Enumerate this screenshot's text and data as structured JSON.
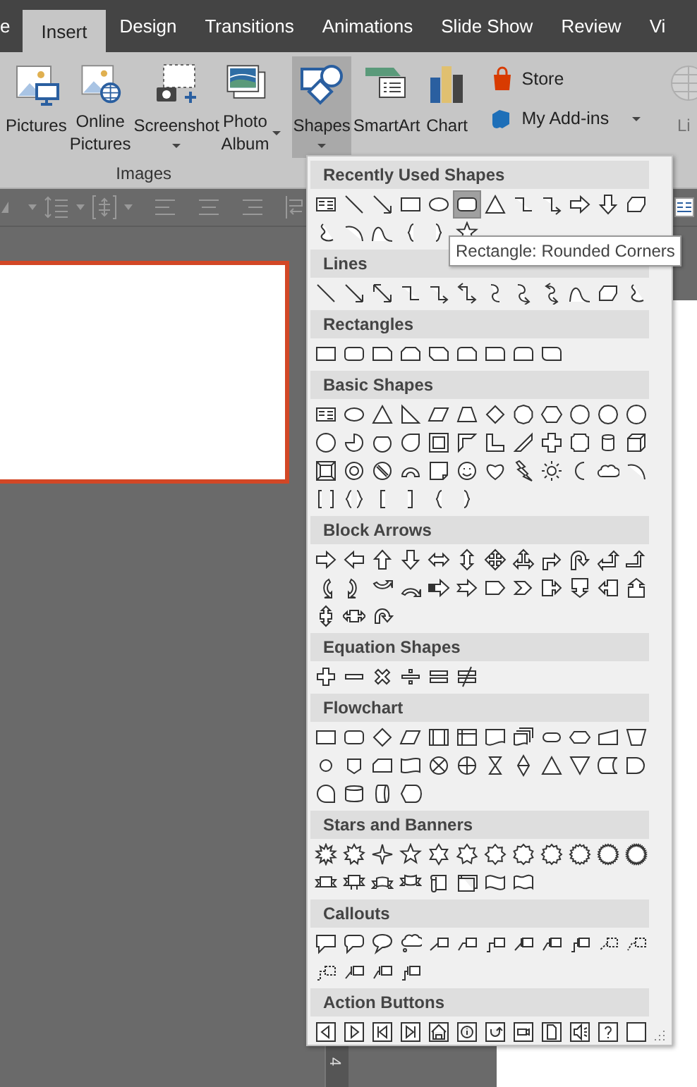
{
  "tabs": [
    {
      "label": "e",
      "selected": false
    },
    {
      "label": "Insert",
      "selected": true
    },
    {
      "label": "Design",
      "selected": false
    },
    {
      "label": "Transitions",
      "selected": false
    },
    {
      "label": "Animations",
      "selected": false
    },
    {
      "label": "Slide Show",
      "selected": false
    },
    {
      "label": "Review",
      "selected": false
    },
    {
      "label": "Vi",
      "selected": false
    }
  ],
  "ribbon": {
    "groups": [
      {
        "label": "Images",
        "buttons": [
          {
            "kind": "pictures",
            "label": "Pictures",
            "dropdown": false,
            "pressed": false,
            "disabled": false
          },
          {
            "kind": "online-pictures",
            "label": "Online Pictures",
            "dropdown": false,
            "pressed": false,
            "disabled": false
          },
          {
            "kind": "screenshot",
            "label": "Screenshot",
            "dropdown": true,
            "pressed": false,
            "disabled": false
          },
          {
            "kind": "photo-album",
            "label": "Photo Album",
            "dropdown": true,
            "pressed": false,
            "disabled": false
          }
        ]
      },
      {
        "buttons": [
          {
            "kind": "shapes",
            "label": "Shapes",
            "dropdown": true,
            "pressed": true,
            "disabled": false
          },
          {
            "kind": "smartart",
            "label": "SmartArt",
            "dropdown": false,
            "pressed": false,
            "disabled": false
          },
          {
            "kind": "chart",
            "label": "Chart",
            "dropdown": false,
            "pressed": false,
            "disabled": false
          }
        ]
      },
      {
        "buttons": [
          {
            "kind": "store",
            "label": "Store",
            "dropdown": false,
            "pressed": false,
            "disabled": false
          },
          {
            "kind": "addins",
            "label": "My Add-ins",
            "dropdown": true,
            "pressed": false,
            "disabled": false
          }
        ]
      },
      {
        "buttons": [
          {
            "kind": "link",
            "label": "Li",
            "dropdown": false,
            "pressed": false,
            "disabled": true
          }
        ]
      }
    ]
  },
  "gallery": {
    "sections": [
      {
        "title": "Recently Used Shapes",
        "items": [
          {
            "selected": false
          },
          {
            "selected": false
          },
          {
            "selected": false
          },
          {
            "selected": false
          },
          {
            "selected": false
          },
          {
            "selected": true
          },
          {
            "selected": false
          },
          {
            "selected": false
          },
          {
            "selected": false
          },
          {
            "selected": false
          },
          {
            "selected": false
          },
          {
            "selected": false
          },
          {
            "selected": false
          },
          {
            "selected": false
          },
          {
            "selected": false
          },
          {
            "selected": false
          },
          {
            "selected": false
          },
          {
            "selected": false
          }
        ]
      },
      {
        "title": "Lines"
      },
      {
        "title": "Rectangles"
      },
      {
        "title": "Basic Shapes"
      },
      {
        "title": "Block Arrows"
      },
      {
        "title": "Equation Shapes"
      },
      {
        "title": "Flowchart"
      },
      {
        "title": "Stars and Banners"
      },
      {
        "title": "Callouts"
      },
      {
        "title": "Action Buttons"
      }
    ],
    "tooltip": "Rectangle: Rounded Corners"
  },
  "ruler_label": "4"
}
